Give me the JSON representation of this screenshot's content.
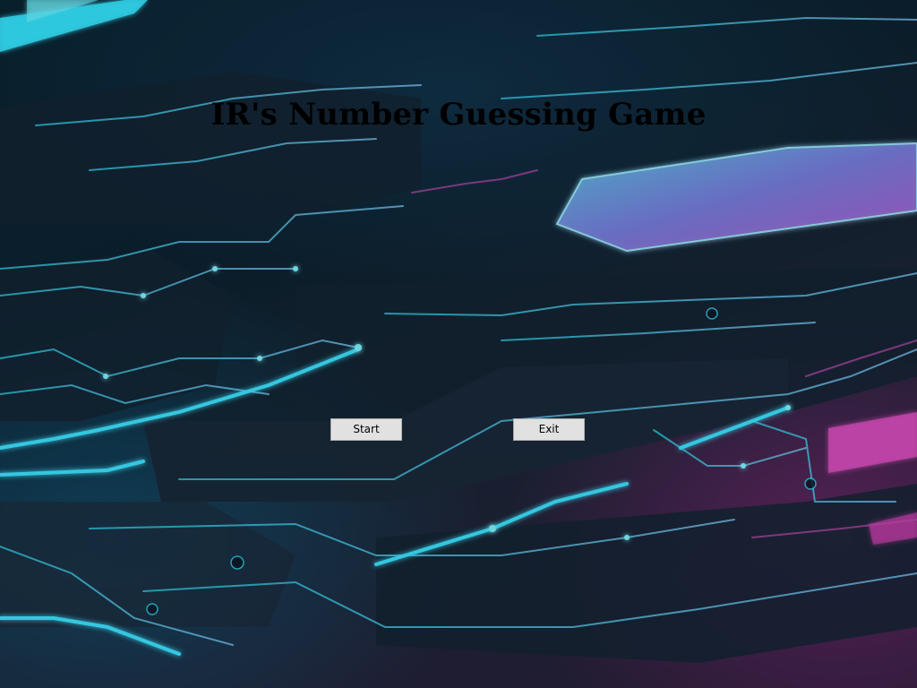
{
  "game": {
    "title": "IR's Number Guessing Game"
  },
  "menu": {
    "start_label": "Start",
    "exit_label": "Exit"
  },
  "theme": {
    "accent_cyan": "#2fd8f0",
    "accent_magenta": "#d94fc0",
    "button_face": "#e1e1e1",
    "button_border": "#adadad",
    "title_color": "#000000"
  }
}
